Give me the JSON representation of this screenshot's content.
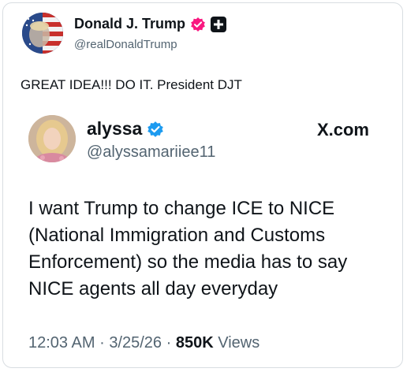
{
  "author": {
    "display_name": "Donald J. Trump",
    "handle": "@realDonaldTrump",
    "verified_color": "#f91880"
  },
  "tweet": {
    "text": "GREAT IDEA!!! DO IT. President DJT"
  },
  "quoted": {
    "display_name": "alyssa",
    "handle": "@alyssamariiee11",
    "source": "X.com",
    "text": "I want Trump to change ICE to NICE (National Immigration and Customs Enforcement) so the media has to say NICE agents all day everyday",
    "time": "12:03 AM",
    "date": "3/25/26",
    "views_count": "850K",
    "views_label": "Views",
    "separator": "·",
    "verified_color": "#1d9bf0"
  }
}
